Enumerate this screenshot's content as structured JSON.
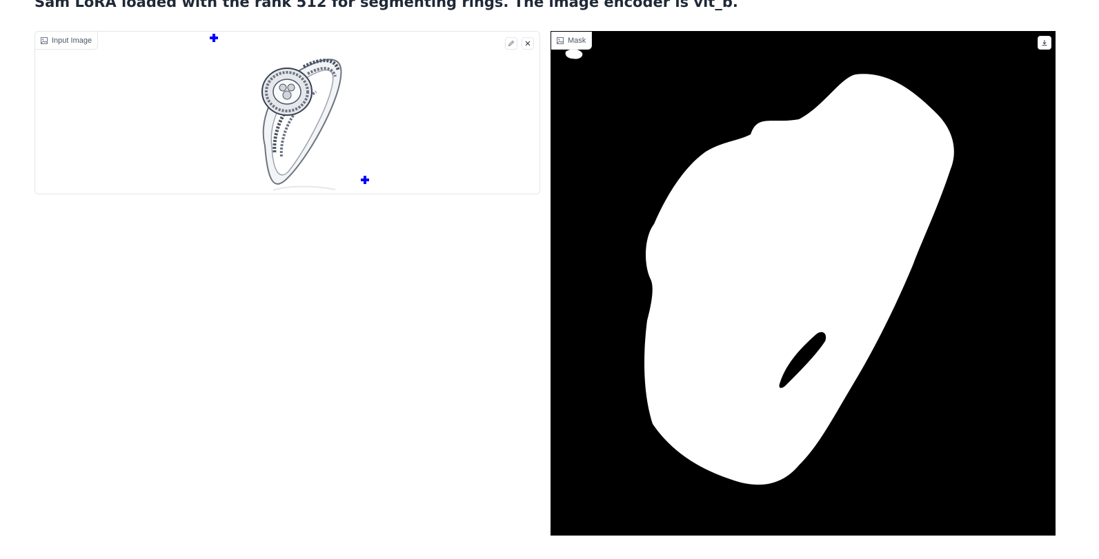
{
  "heading": "Sam LoRA loaded with the rank 512 for segmenting rings. The image encoder is vit_b.",
  "input_panel": {
    "label": "Input Image",
    "label_icon": "image-icon",
    "edit_icon": "pencil-icon",
    "clear_icon": "close-icon",
    "point_color": "#0000ff"
  },
  "mask_panel": {
    "label": "Mask",
    "label_icon": "image-icon",
    "download_icon": "download-icon",
    "background_color": "#000000",
    "mask_color": "#ffffff"
  }
}
